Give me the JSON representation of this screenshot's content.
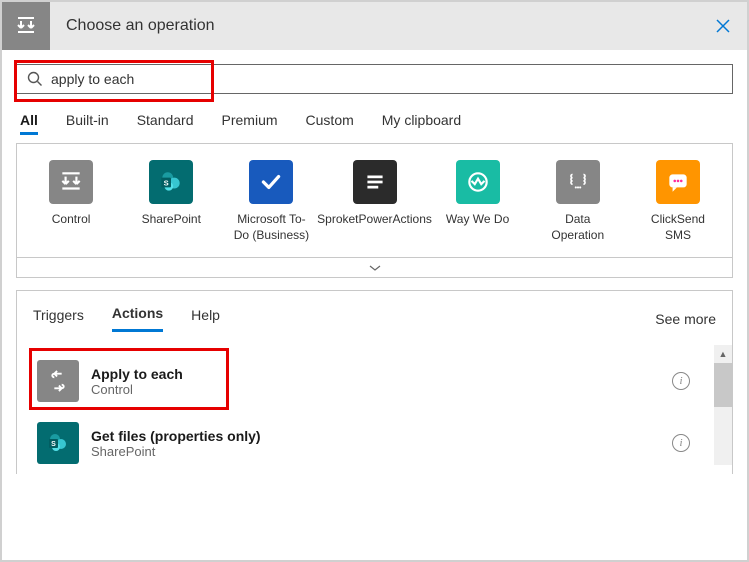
{
  "titlebar": {
    "title": "Choose an operation"
  },
  "search": {
    "value": "apply to each"
  },
  "filter_tabs": [
    {
      "label": "All",
      "active": true
    },
    {
      "label": "Built-in",
      "active": false
    },
    {
      "label": "Standard",
      "active": false
    },
    {
      "label": "Premium",
      "active": false
    },
    {
      "label": "Custom",
      "active": false
    },
    {
      "label": "My clipboard",
      "active": false
    }
  ],
  "connectors": [
    {
      "label": "Control",
      "bg": "#868686",
      "icon": "control"
    },
    {
      "label": "SharePoint",
      "bg": "#036c70",
      "icon": "sharepoint"
    },
    {
      "label": "Microsoft To-Do (Business)",
      "bg": "#185abd",
      "icon": "todo"
    },
    {
      "label": "SproketPowerActions",
      "bg": "#2b2b2b",
      "icon": "sproket"
    },
    {
      "label": "Way We Do",
      "bg": "#19bca4",
      "icon": "wayweedo"
    },
    {
      "label": "Data Operation",
      "bg": "#868686",
      "icon": "dataop"
    },
    {
      "label": "ClickSend SMS",
      "bg": "#ff9500",
      "icon": "clicksend"
    }
  ],
  "sub_tabs": {
    "triggers": "Triggers",
    "actions": "Actions",
    "help": "Help",
    "see_more": "See more",
    "active": "actions"
  },
  "actions": [
    {
      "title": "Apply to each",
      "subtitle": "Control",
      "bg": "#868686",
      "icon": "applyeach",
      "highlighted": true
    },
    {
      "title": "Get files (properties only)",
      "subtitle": "SharePoint",
      "bg": "#036c70",
      "icon": "sharepoint",
      "highlighted": false
    }
  ]
}
